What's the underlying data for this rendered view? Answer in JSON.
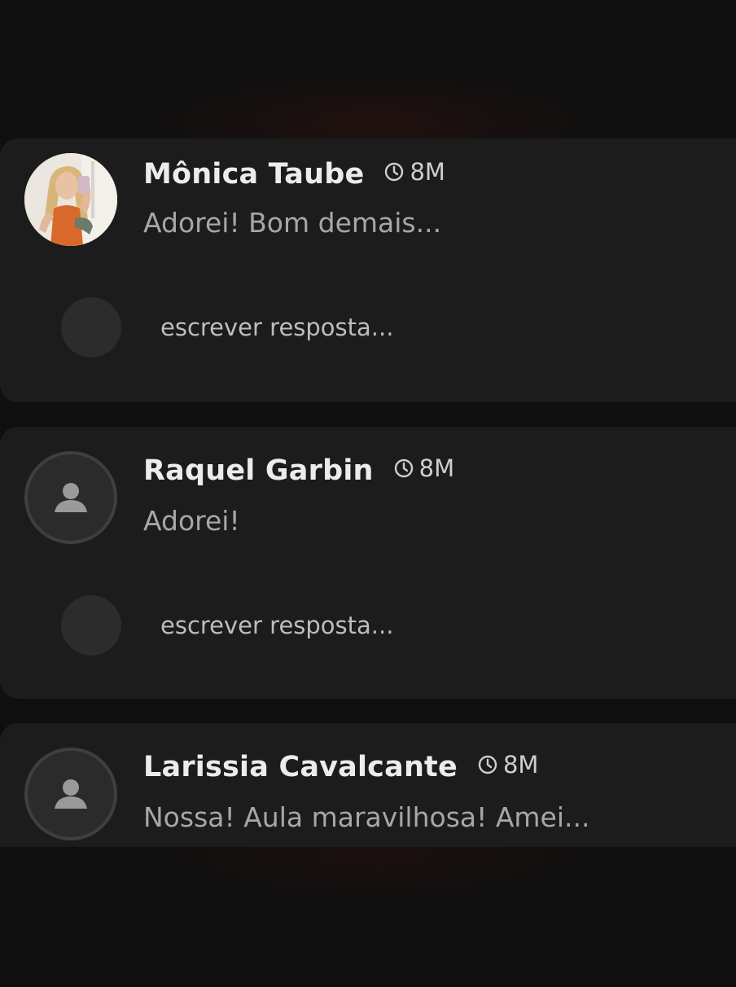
{
  "comments": [
    {
      "author": "Mônica Taube",
      "time": "8M",
      "text": "Adorei! Bom demais...",
      "avatar": "photo",
      "reply_placeholder": "escrever resposta..."
    },
    {
      "author": "Raquel Garbin",
      "time": "8M",
      "text": "Adorei!",
      "avatar": "default-user-icon",
      "reply_placeholder": "escrever resposta..."
    },
    {
      "author": "Larissia Cavalcante",
      "time": "8M",
      "text": "Nossa! Aula maravilhosa! Amei...",
      "avatar": "default-user-icon"
    }
  ],
  "colors": {
    "background": "#0f0f0f",
    "card": "#1c1c1c",
    "author": "#ececec",
    "message": "#a7a7a7"
  }
}
